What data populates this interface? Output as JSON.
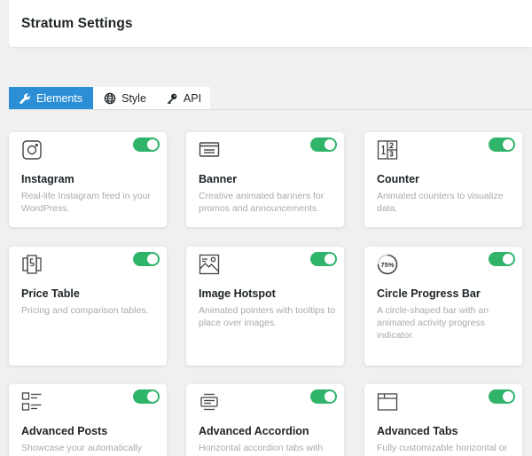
{
  "header": {
    "title": "Stratum Settings"
  },
  "tabs": [
    {
      "label": "Elements",
      "icon": "wrench-icon",
      "active": true
    },
    {
      "label": "Style",
      "icon": "globe-icon",
      "active": false
    },
    {
      "label": "API",
      "icon": "key-icon",
      "active": false
    }
  ],
  "colors": {
    "accent": "#2c8fd6",
    "toggle_on": "#2fb46a"
  },
  "elements": [
    {
      "title": "Instagram",
      "desc": "Real-life Instagram feed in your WordPress.",
      "icon": "instagram-icon",
      "enabled": true
    },
    {
      "title": "Banner",
      "desc": "Creative animated banners for promos and announcements.",
      "icon": "banner-icon",
      "enabled": true
    },
    {
      "title": "Counter",
      "desc": "Animated counters to visualize data.",
      "icon": "counter-icon",
      "enabled": true
    },
    {
      "title": "Price Table",
      "desc": "Pricing and comparison tables.",
      "icon": "price-table-icon",
      "enabled": true
    },
    {
      "title": "Image Hotspot",
      "desc": "Animated pointers with tooltips to place over images.",
      "icon": "image-hotspot-icon",
      "enabled": true
    },
    {
      "title": "Circle Progress Bar",
      "desc": "A circle-shaped bar with an animated activity progress indicator.",
      "icon": "circle-progress-icon",
      "icon_text": "75%",
      "enabled": true
    },
    {
      "title": "Advanced Posts",
      "desc": "Showcase your automatically",
      "icon": "advanced-posts-icon",
      "enabled": true
    },
    {
      "title": "Advanced Accordion",
      "desc": "Horizontal accordion tabs with",
      "icon": "accordion-icon",
      "enabled": true
    },
    {
      "title": "Advanced Tabs",
      "desc": "Fully customizable horizontal or",
      "icon": "tabs-icon",
      "enabled": true
    }
  ]
}
